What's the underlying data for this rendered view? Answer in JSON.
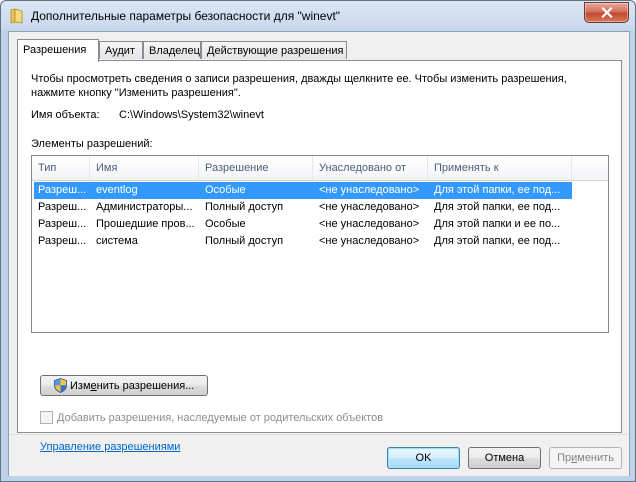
{
  "window": {
    "title": "Дополнительные параметры безопасности  для \"winevt\""
  },
  "tabs": [
    {
      "label": "Разрешения",
      "active": true
    },
    {
      "label": "Аудит",
      "active": false
    },
    {
      "label": "Владелец",
      "active": false
    },
    {
      "label": "Действующие разрешения",
      "active": false
    }
  ],
  "permissions": {
    "description_line1": "Чтобы просмотреть сведения о записи разрешения, дважды щелкните ее. Чтобы изменить разрешения,",
    "description_line2": "нажмите кнопку \"Изменить разрешения\".",
    "object_label": "Имя объекта:",
    "object_value": "C:\\Windows\\System32\\winevt",
    "entries_label": "Элементы разрешений:",
    "columns": [
      "Тип",
      "Имя",
      "Разрешение",
      "Унаследовано от",
      "Применять к"
    ],
    "rows": [
      [
        "Разреш...",
        "eventlog",
        "Особые",
        "<не унаследовано>",
        "Для этой папки, ее под..."
      ],
      [
        "Разреш...",
        "Администраторы...",
        "Полный доступ",
        "<не унаследовано>",
        "Для этой папки, ее под..."
      ],
      [
        "Разреш...",
        "Прошедшие пров...",
        "Особые",
        "<не унаследовано>",
        "Для этой папки и ее по..."
      ],
      [
        "Разреш...",
        "система",
        "Полный доступ",
        "<не унаследовано>",
        "Для этой папки, ее под..."
      ]
    ],
    "selected_row": 0,
    "edit_button_pre": "Изм",
    "edit_button_mnemonic": "е",
    "edit_button_post": "нить разрешения...",
    "inherit_pre": "",
    "inherit_mnemonic": "Д",
    "inherit_post": "обавить разрешения, наследуемые от родительских объектов",
    "inherit_checked": false,
    "inherit_enabled": false,
    "manage_link": "Управление разрешениями"
  },
  "buttons": {
    "ok": "OK",
    "cancel": "Отмена",
    "apply_pre": "Пр",
    "apply_mnemonic": "и",
    "apply_post": "менить"
  },
  "colors": {
    "selection": "#3399ff",
    "link": "#0066cc",
    "close_button": "#c14a30"
  }
}
